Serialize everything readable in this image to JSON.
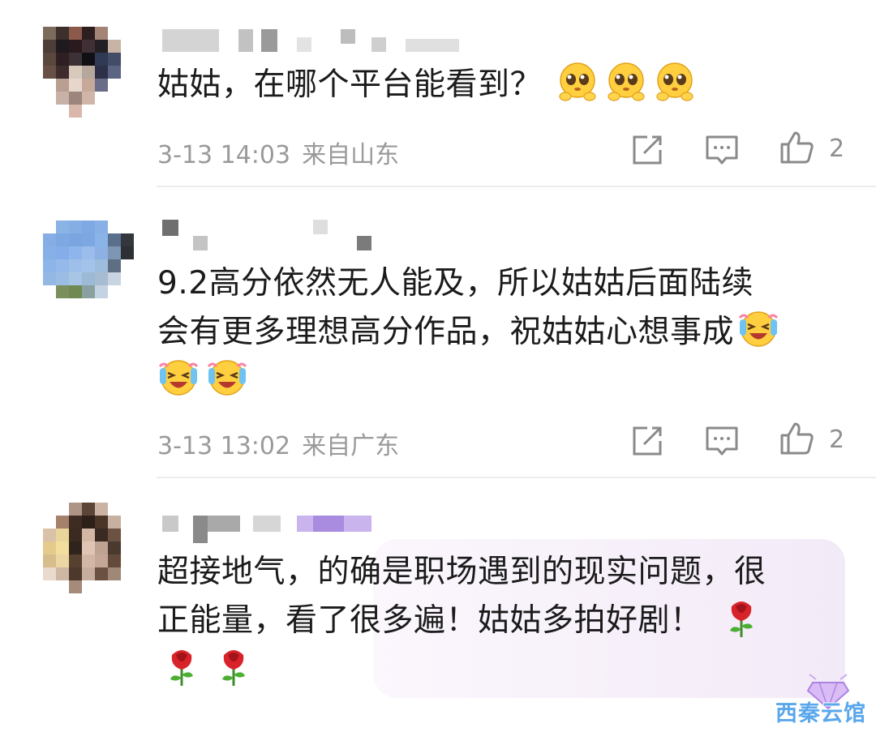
{
  "comments": [
    {
      "text": "姑姑，在哪个平台能看到？",
      "emojis": [
        "shy-emoji",
        "shy-emoji",
        "shy-emoji"
      ],
      "time": "3-13 14:03",
      "location": "来自山东",
      "likes": "2"
    },
    {
      "text_line1": "9.2高分依然无人能及，所以姑姑后面陆续",
      "text_line2": "会有更多理想高分作品，祝姑姑心想事成",
      "emojis": [
        "laugh-cry-emoji",
        "laugh-cry-emoji",
        "laugh-cry-emoji"
      ],
      "time": "3-13 13:02",
      "location": "来自广东",
      "likes": "2"
    },
    {
      "text_line1": "超接地气，的确是职场遇到的现实问题，很",
      "text_line2": "正能量，看了很多遍！姑姑多拍好剧！",
      "emojis": [
        "rose-emoji",
        "rose-emoji",
        "rose-emoji"
      ]
    }
  ],
  "watermark": "西秦云馆",
  "icons": {
    "share": "share-icon",
    "comment": "comment-icon",
    "like": "thumbs-up-icon"
  },
  "colors": {
    "meta_text": "#9a9a9a",
    "fan_bubble": "#f3eaf7",
    "watermark": "#5aa7ec"
  }
}
